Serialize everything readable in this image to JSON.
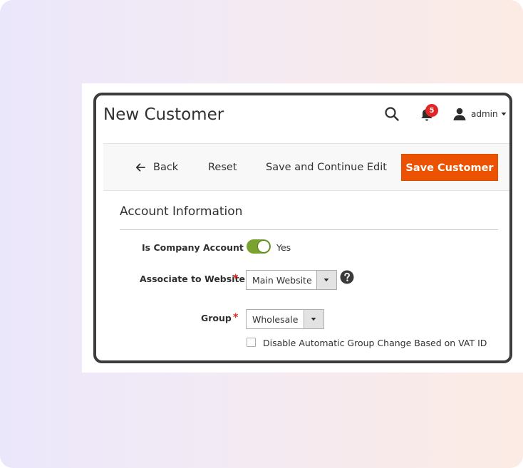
{
  "header": {
    "title": "New Customer",
    "notification_count": "5",
    "username": "admin"
  },
  "toolbar": {
    "back_label": "Back",
    "reset_label": "Reset",
    "save_continue_label": "Save and Continue Edit",
    "save_label": "Save Customer"
  },
  "account": {
    "section_title": "Account Information",
    "company_label": "Is Company Account",
    "company_value": "Yes",
    "website_label": "Associate to Website",
    "website_value": "Main Website",
    "group_label": "Group",
    "group_value": "Wholesale",
    "vat_label": "Disable Automatic Group Change Based on VAT ID"
  },
  "colors": {
    "accent": "#eb5202",
    "toggle_on": "#79a22e",
    "required": "#e22626",
    "badge": "#e22626"
  },
  "icons": [
    "search-icon",
    "bell-icon",
    "user-icon",
    "chevron-down-icon",
    "arrow-left-icon",
    "help-icon"
  ]
}
